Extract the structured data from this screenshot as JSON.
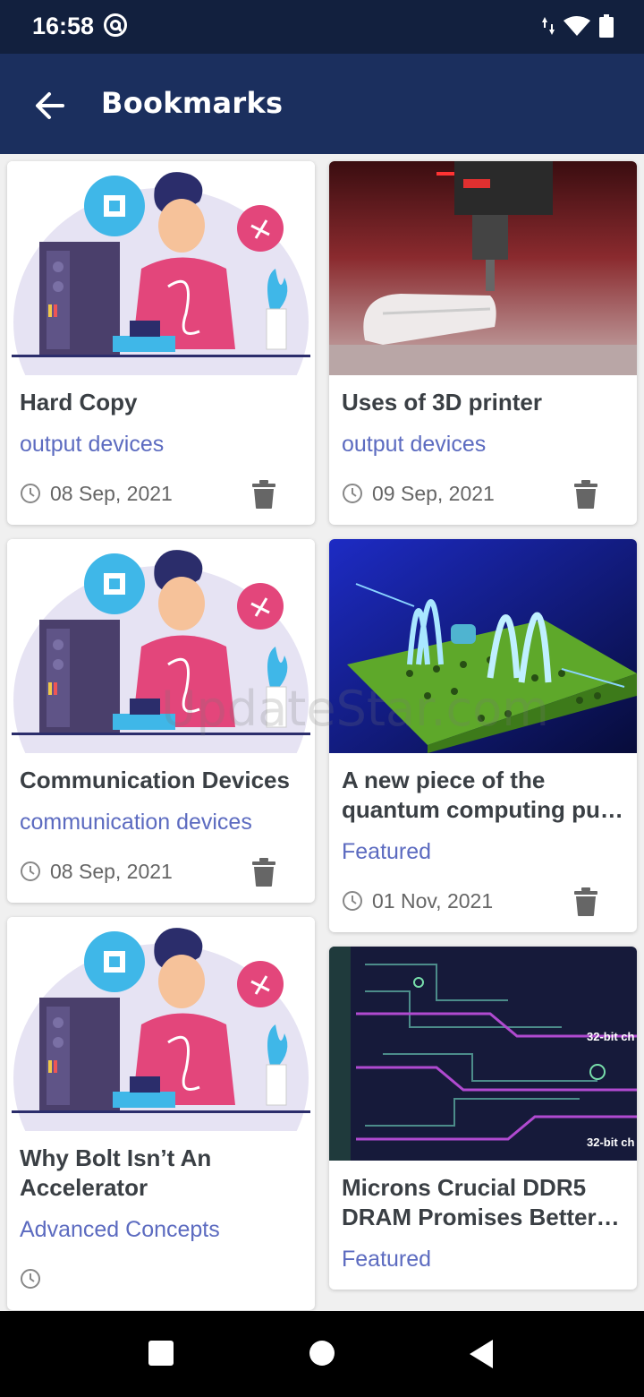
{
  "status": {
    "time": "16:58"
  },
  "appbar": {
    "title": "Bookmarks"
  },
  "watermark": "UpdateStar.com",
  "bookmarks": [
    {
      "title": "Hard Copy",
      "category": "output devices",
      "date": "08 Sep, 2021",
      "image": "illustration-icon"
    },
    {
      "title": "Uses of 3D printer",
      "category": "output devices",
      "date": "09 Sep, 2021",
      "image": "3d-printer-photo"
    },
    {
      "title": "Communication Devices",
      "category": "communication devices",
      "date": "08 Sep, 2021",
      "image": "illustration-icon"
    },
    {
      "title": "A new piece of the quantum computing pu…",
      "category": "Featured",
      "date": "01 Nov, 2021",
      "image": "quantum-photo"
    },
    {
      "title": "Why Bolt Isn’t An Accelerator",
      "category": "Advanced Concepts",
      "date": "",
      "image": "illustration-icon"
    },
    {
      "title": "Microns Crucial DDR5 DRAM Promises Better …",
      "category": "Featured",
      "date": "",
      "image": "circuit-photo"
    }
  ],
  "circuit_labels": [
    "32-bit ch",
    "32-bit ch"
  ],
  "colors": {
    "statusbar": "#12203e",
    "appbar": "#1b2f5e",
    "category": "#5c6bc0",
    "title": "#3a3f44"
  }
}
